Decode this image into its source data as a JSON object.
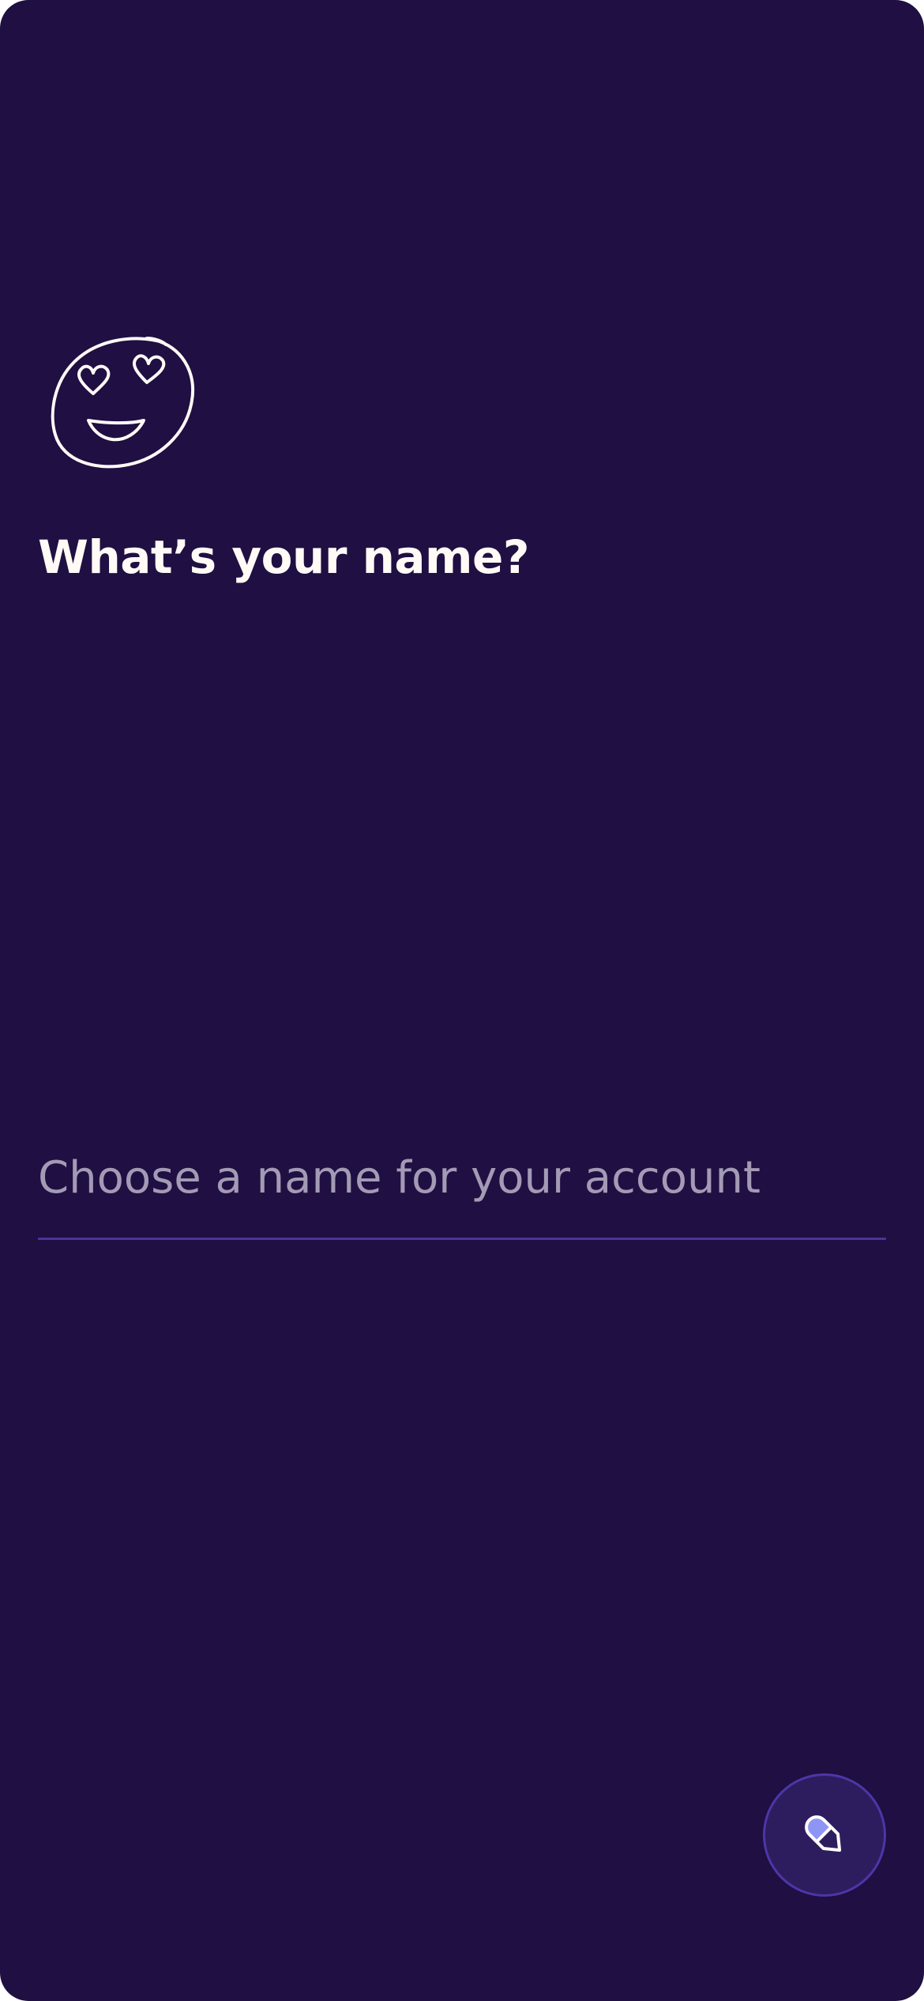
{
  "onboarding": {
    "title": "What’s your name?",
    "name_field": {
      "value": "",
      "placeholder": "Choose a name for your account"
    },
    "illustration_icon": "heart-eyes-face-icon",
    "fab_icon": "pencil-icon"
  },
  "colors": {
    "background": "#1f0f42",
    "title_text": "#fffaf6",
    "placeholder_text": "#a39ab5",
    "underline": "#4a3498",
    "fab_background": "#2e1d5e",
    "fab_border": "#4d36a8",
    "pencil_accent": "#8f95f5"
  }
}
